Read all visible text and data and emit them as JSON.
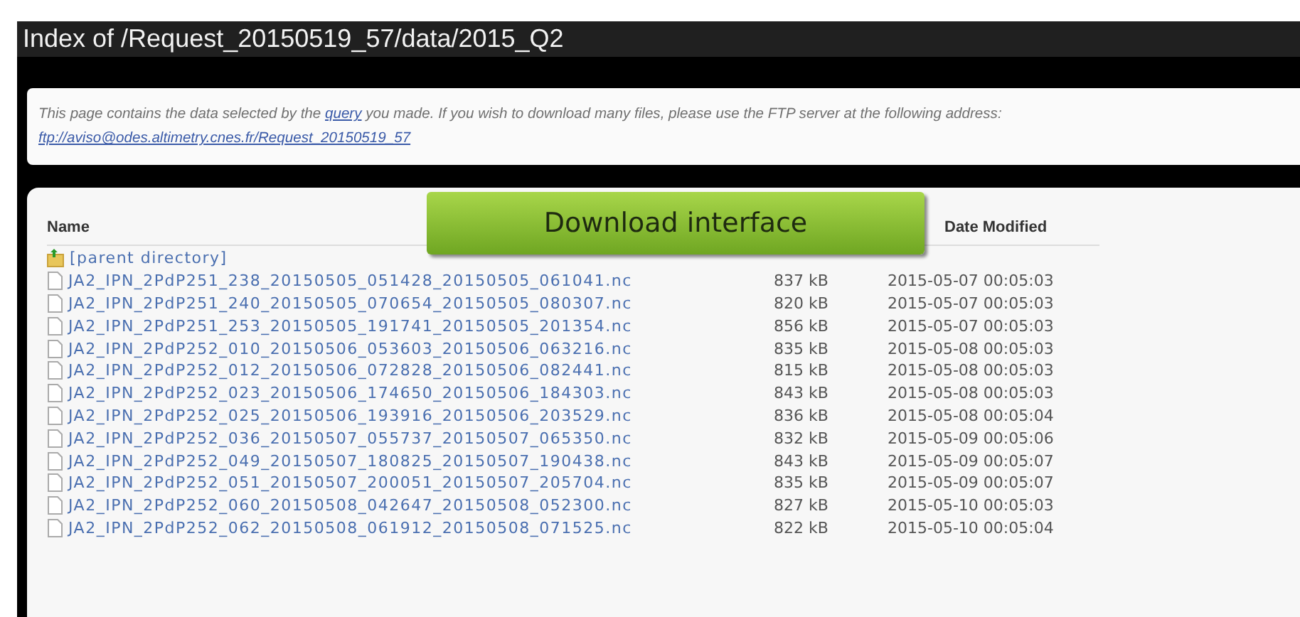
{
  "window": {
    "title": "Index of /Request_20150519_57/data/2015_Q2"
  },
  "notice": {
    "before": "This page contains the data selected by the ",
    "link": "query",
    "middle": " you made. If you wish to download many files, please use the FTP server at the following address: ",
    "address": "ftp://aviso@odes.altimetry.cnes.fr/Request_20150519_57"
  },
  "overlay": {
    "label": "Download interface"
  },
  "table": {
    "columns": [
      "Name",
      "Date Modified"
    ],
    "parent": {
      "label": "[parent directory]"
    },
    "rows": [
      {
        "name": "JA2_IPN_2PdP251_238_20150505_051428_20150505_061041.nc",
        "size": "837 kB",
        "date": "2015-05-07 00:05:03"
      },
      {
        "name": "JA2_IPN_2PdP251_240_20150505_070654_20150505_080307.nc",
        "size": "820 kB",
        "date": "2015-05-07 00:05:03"
      },
      {
        "name": "JA2_IPN_2PdP251_253_20150505_191741_20150505_201354.nc",
        "size": "856 kB",
        "date": "2015-05-07 00:05:03"
      },
      {
        "name": "JA2_IPN_2PdP252_010_20150506_053603_20150506_063216.nc",
        "size": "835 kB",
        "date": "2015-05-08 00:05:03"
      },
      {
        "name": "JA2_IPN_2PdP252_012_20150506_072828_20150506_082441.nc",
        "size": "815 kB",
        "date": "2015-05-08 00:05:03"
      },
      {
        "name": "JA2_IPN_2PdP252_023_20150506_174650_20150506_184303.nc",
        "size": "843 kB",
        "date": "2015-05-08 00:05:03"
      },
      {
        "name": "JA2_IPN_2PdP252_025_20150506_193916_20150506_203529.nc",
        "size": "836 kB",
        "date": "2015-05-08 00:05:04"
      },
      {
        "name": "JA2_IPN_2PdP252_036_20150507_055737_20150507_065350.nc",
        "size": "832 kB",
        "date": "2015-05-09 00:05:06"
      },
      {
        "name": "JA2_IPN_2PdP252_049_20150507_180825_20150507_190438.nc",
        "size": "843 kB",
        "date": "2015-05-09 00:05:07"
      },
      {
        "name": "JA2_IPN_2PdP252_051_20150507_200051_20150507_205704.nc",
        "size": "835 kB",
        "date": "2015-05-09 00:05:07"
      },
      {
        "name": "JA2_IPN_2PdP252_060_20150508_042647_20150508_052300.nc",
        "size": "827 kB",
        "date": "2015-05-10 00:05:03"
      },
      {
        "name": "JA2_IPN_2PdP252_062_20150508_061912_20150508_071525.nc",
        "size": "822 kB",
        "date": "2015-05-10 00:05:04"
      }
    ]
  }
}
